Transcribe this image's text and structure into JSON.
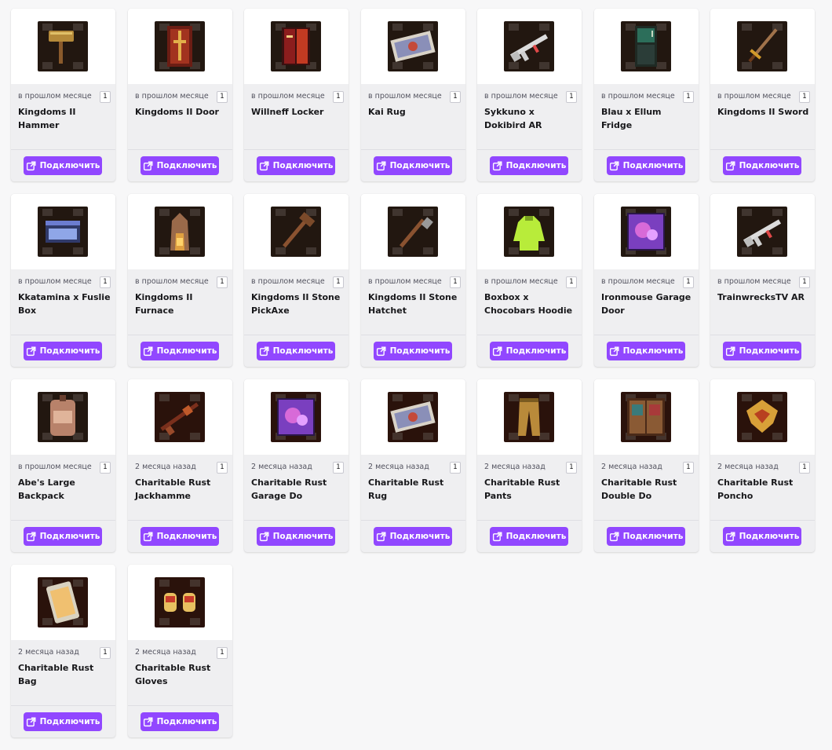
{
  "connect_label": "Подключить",
  "accent_color": "#9147ff",
  "items": [
    {
      "time": "в прошлом месяце",
      "qty": "1",
      "title": "Kingdoms II Hammer",
      "icon": "hammer-icon"
    },
    {
      "time": "в прошлом месяце",
      "qty": "1",
      "title": "Kingdoms II Door",
      "icon": "door-icon"
    },
    {
      "time": "в прошлом месяце",
      "qty": "1",
      "title": "Willneff Locker",
      "icon": "locker-icon"
    },
    {
      "time": "в прошлом месяце",
      "qty": "1",
      "title": "Kai Rug",
      "icon": "rug-icon"
    },
    {
      "time": "в прошлом месяце",
      "qty": "1",
      "title": "Sykkuno x Dokibird AR",
      "icon": "rifle-icon"
    },
    {
      "time": "в прошлом месяце",
      "qty": "1",
      "title": "Blau x Ellum Fridge",
      "icon": "fridge-icon"
    },
    {
      "time": "в прошлом месяце",
      "qty": "1",
      "title": "Kingdoms II Sword",
      "icon": "sword-icon"
    },
    {
      "time": "в прошлом месяце",
      "qty": "1",
      "title": "Kkatamina x Fuslie Box",
      "icon": "box-icon"
    },
    {
      "time": "в прошлом месяце",
      "qty": "1",
      "title": "Kingdoms II Furnace",
      "icon": "furnace-icon"
    },
    {
      "time": "в прошлом месяце",
      "qty": "1",
      "title": "Kingdoms II Stone PickAxe",
      "icon": "pickaxe-icon"
    },
    {
      "time": "в прошлом месяце",
      "qty": "1",
      "title": "Kingdoms II Stone Hatchet",
      "icon": "hatchet-icon"
    },
    {
      "time": "в прошлом месяце",
      "qty": "1",
      "title": "Boxbox x Chocobars Hoodie",
      "icon": "hoodie-icon"
    },
    {
      "time": "в прошлом месяце",
      "qty": "1",
      "title": "Ironmouse Garage Door",
      "icon": "garage-door-icon"
    },
    {
      "time": "в прошлом месяце",
      "qty": "1",
      "title": "TrainwrecksTV AR",
      "icon": "rifle-icon"
    },
    {
      "time": "в прошлом месяце",
      "qty": "1",
      "title": "Abe's Large Backpack",
      "icon": "backpack-icon"
    },
    {
      "time": "2 месяца назад",
      "qty": "1",
      "title": "Charitable Rust Jackhamme",
      "icon": "jackhammer-icon"
    },
    {
      "time": "2 месяца назад",
      "qty": "1",
      "title": "Charitable Rust Garage Do",
      "icon": "garage-door-icon"
    },
    {
      "time": "2 месяца назад",
      "qty": "1",
      "title": "Charitable Rust Rug",
      "icon": "rug-icon"
    },
    {
      "time": "2 месяца назад",
      "qty": "1",
      "title": "Charitable Rust Pants",
      "icon": "pants-icon"
    },
    {
      "time": "2 месяца назад",
      "qty": "1",
      "title": "Charitable Rust Double Do",
      "icon": "double-door-icon"
    },
    {
      "time": "2 месяца назад",
      "qty": "1",
      "title": "Charitable Rust Poncho",
      "icon": "poncho-icon"
    },
    {
      "time": "2 месяца назад",
      "qty": "1",
      "title": "Charitable Rust Bag",
      "icon": "bag-icon"
    },
    {
      "time": "2 месяца назад",
      "qty": "1",
      "title": "Charitable Rust Gloves",
      "icon": "gloves-icon"
    }
  ]
}
